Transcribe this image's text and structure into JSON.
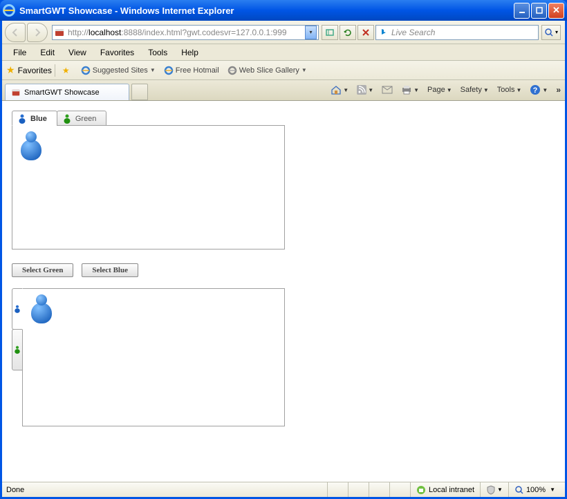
{
  "window": {
    "title": "SmartGWT Showcase - Windows Internet Explorer"
  },
  "address": {
    "prefix": "http://",
    "host": "localhost",
    "rest": ":8888/index.html?gwt.codesvr=127.0.0.1:999",
    "search_placeholder": "Live Search"
  },
  "menu": {
    "file": "File",
    "edit": "Edit",
    "view": "View",
    "favorites": "Favorites",
    "tools": "Tools",
    "help": "Help"
  },
  "fav": {
    "favorites_label": "Favorites",
    "suggested": "Suggested Sites",
    "hotmail": "Free Hotmail",
    "webslice": "Web Slice Gallery"
  },
  "browser_tab": {
    "title": "SmartGWT Showcase"
  },
  "cmdbar": {
    "page": "Page",
    "safety": "Safety",
    "tools": "Tools"
  },
  "tabs": {
    "blue": "Blue",
    "green": "Green"
  },
  "buttons": {
    "select_green": "Select Green",
    "select_blue": "Select Blue"
  },
  "status": {
    "done": "Done",
    "zone": "Local intranet",
    "zoom": "100%"
  }
}
